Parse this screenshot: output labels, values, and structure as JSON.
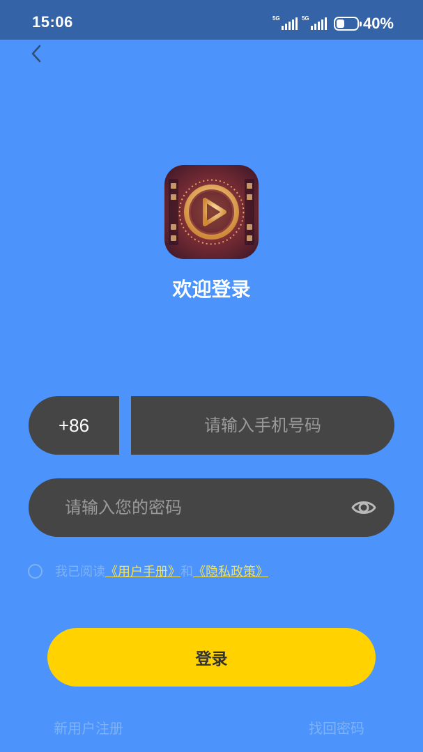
{
  "status_bar": {
    "time": "15:06",
    "signal_1_label": "5G",
    "signal_2_label": "5G",
    "battery_percent": "40%",
    "battery_level": 0.4
  },
  "header": {
    "back_icon": "chevron-left-icon"
  },
  "app": {
    "icon": "play-film-icon",
    "welcome_title": "欢迎登录"
  },
  "form": {
    "country_code": "+86",
    "phone_placeholder": "请输入手机号码",
    "phone_value": "",
    "password_placeholder": "请输入您的密码",
    "password_value": "",
    "eye_icon": "eye-icon"
  },
  "agreement": {
    "prefix": "我已阅读",
    "user_manual_link": "《用户手册》",
    "conjunction": "和",
    "privacy_link": "《隐私政策》",
    "checked": false
  },
  "actions": {
    "login_label": "登录",
    "register_label": "新用户注册",
    "forgot_label": "找回密码"
  },
  "colors": {
    "background": "#4c94fb",
    "status_bar": "#3463a8",
    "input_bg": "#454545",
    "button": "#ffd200",
    "link": "#f2e05a"
  }
}
